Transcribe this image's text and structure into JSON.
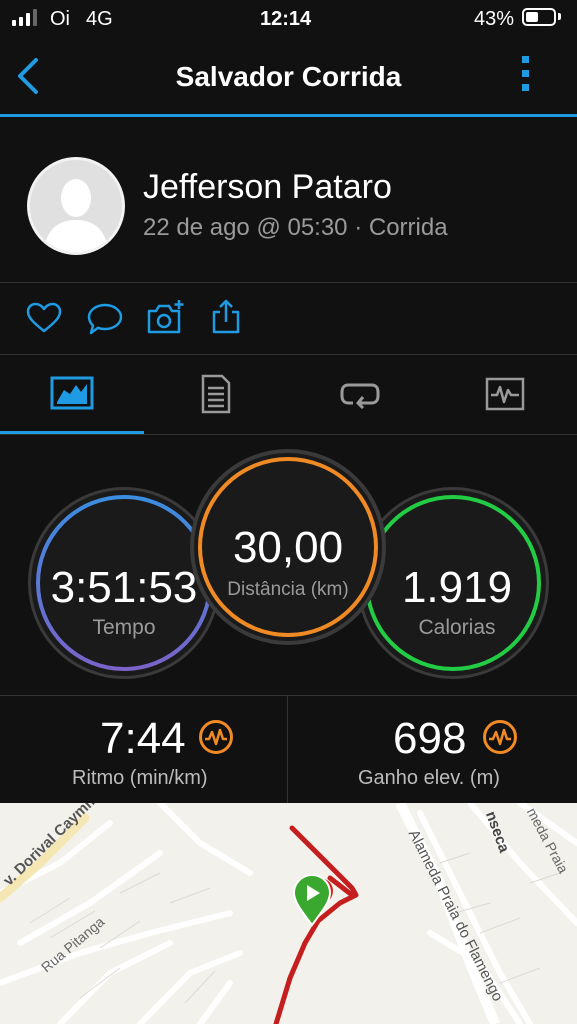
{
  "status_bar": {
    "carrier": "Oi",
    "network": "4G",
    "time": "12:14",
    "battery": "43%"
  },
  "header": {
    "title": "Salvador Corrida"
  },
  "profile": {
    "name": "Jefferson Pataro",
    "meta": "22 de ago @ 05:30 · Corrida"
  },
  "actions": [
    "like-icon",
    "comment-icon",
    "add-photo-icon",
    "share-icon"
  ],
  "tabs": [
    {
      "icon": "overview-tab-icon",
      "active": true
    },
    {
      "icon": "stats-tab-icon",
      "active": false
    },
    {
      "icon": "laps-tab-icon",
      "active": false
    },
    {
      "icon": "charts-tab-icon",
      "active": false
    }
  ],
  "stats": {
    "time": {
      "value": "3:51:53",
      "label": "Tempo"
    },
    "distance": {
      "value": "30,00",
      "label": "Distância (km)"
    },
    "calories": {
      "value": "1.919",
      "label": "Calorias"
    }
  },
  "metrics": {
    "pace": {
      "value": "7:44",
      "label": "Ritmo (min/km)"
    },
    "elevation": {
      "value": "698",
      "label": "Ganho elev. (m)"
    }
  },
  "map": {
    "streets": [
      "v. Dorival Caymmi",
      "Rua Pitanga",
      "Alameda Praia do Flamengo",
      "nseca",
      "meda Praia"
    ]
  },
  "colors": {
    "accent": "#1e9be3",
    "time": "#4f8ee0",
    "distance": "#f08a24",
    "calories": "#22cc44",
    "route": "#c41e1e",
    "start": "#3aa82f"
  }
}
